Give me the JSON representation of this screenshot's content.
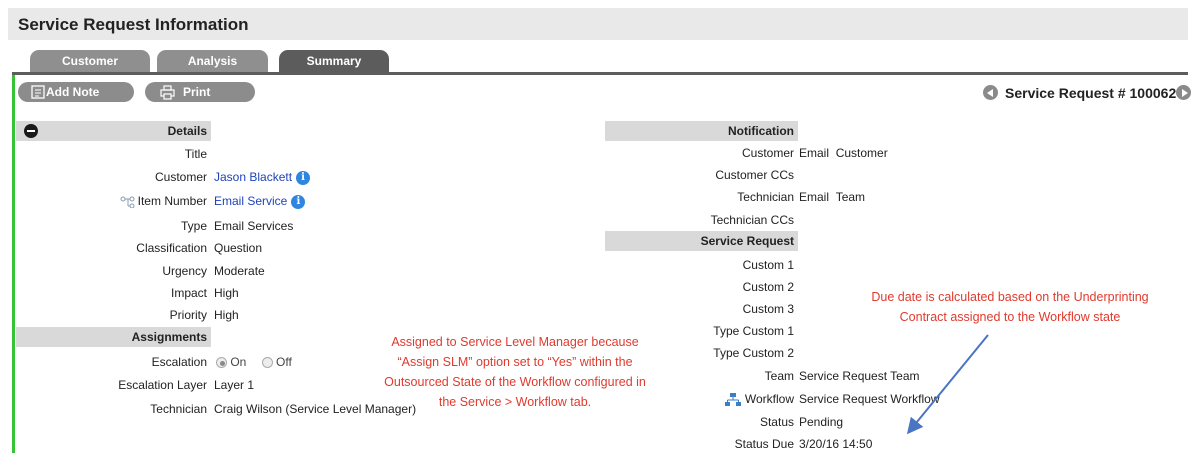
{
  "header": {
    "title": "Service Request Information"
  },
  "tabs": [
    {
      "label": "Customer",
      "active": false
    },
    {
      "label": "Analysis",
      "active": false
    },
    {
      "label": "Summary",
      "active": true
    }
  ],
  "toolbar": {
    "add_note_label": "Add Note",
    "print_label": "Print"
  },
  "request_nav": {
    "label": "Service Request # 100062"
  },
  "details": {
    "heading": "Details",
    "title_label": "Title",
    "title_value": "",
    "customer_label": "Customer",
    "customer_value": "Jason Blackett",
    "item_number_label": "Item Number",
    "item_number_value": "Email Service",
    "type_label": "Type",
    "type_value": "Email Services",
    "classification_label": "Classification",
    "classification_value": "Question",
    "urgency_label": "Urgency",
    "urgency_value": "Moderate",
    "impact_label": "Impact",
    "impact_value": "High",
    "priority_label": "Priority",
    "priority_value": "High"
  },
  "assignments": {
    "heading": "Assignments",
    "escalation_label": "Escalation",
    "escalation_on": "On",
    "escalation_off": "Off",
    "escalation_selected": "On",
    "escalation_layer_label": "Escalation Layer",
    "escalation_layer_value": "Layer 1",
    "technician_label": "Technician",
    "technician_value": "Craig Wilson (Service Level Manager)"
  },
  "notification": {
    "heading": "Notification",
    "customer_label": "Customer",
    "customer_method": "Email",
    "customer_target": "Customer",
    "customer_ccs_label": "Customer CCs",
    "technician_label": "Technician",
    "technician_method": "Email",
    "technician_target": "Team",
    "technician_ccs_label": "Technician CCs"
  },
  "service_request": {
    "heading": "Service Request",
    "custom1_label": "Custom 1",
    "custom2_label": "Custom 2",
    "custom3_label": "Custom 3",
    "type_custom1_label": "Type Custom 1",
    "type_custom2_label": "Type Custom 2",
    "team_label": "Team",
    "team_value": "Service Request Team",
    "workflow_label": "Workflow",
    "workflow_value": "Service Request Workflow",
    "status_label": "Status",
    "status_value": "Pending",
    "status_due_label": "Status Due",
    "status_due_value": "3/20/16 14:50"
  },
  "annotations": {
    "slm_lines": [
      "Assigned to Service Level Manager because",
      "“Assign SLM” option set to “Yes” within the",
      "Outsourced State of the Workflow configured in",
      "the Service > Workflow tab."
    ],
    "due_lines": [
      "Due date is calculated based on the Underprinting",
      "Contract assigned to the Workflow state"
    ],
    "color": "#e03a2e",
    "arrow_color": "#4a74c4"
  }
}
